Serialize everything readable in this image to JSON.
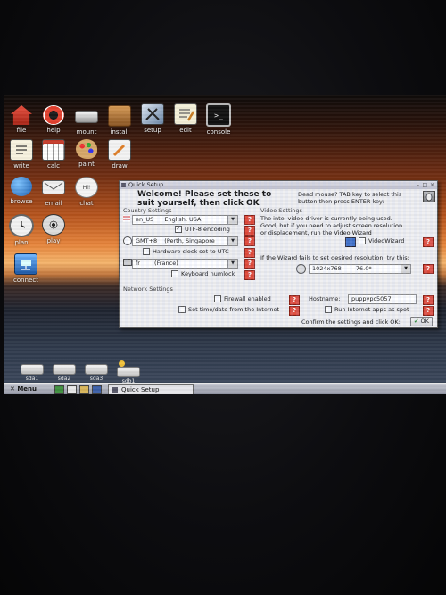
{
  "desktop": {
    "icons": [
      {
        "label": "file",
        "icon": "file-manager-icon"
      },
      {
        "label": "help",
        "icon": "help-lifebuoy-icon"
      },
      {
        "label": "mount",
        "icon": "drive-mount-icon"
      },
      {
        "label": "install",
        "icon": "install-box-icon"
      },
      {
        "label": "setup",
        "icon": "setup-tools-icon"
      },
      {
        "label": "edit",
        "icon": "text-editor-icon"
      },
      {
        "label": "console",
        "icon": "terminal-icon"
      },
      {
        "label": "write",
        "icon": "word-processor-icon"
      },
      {
        "label": "calc",
        "icon": "spreadsheet-icon"
      },
      {
        "label": "paint",
        "icon": "paint-palette-icon"
      },
      {
        "label": "draw",
        "icon": "draw-pencil-icon"
      },
      {
        "label": "browse",
        "icon": "globe-browser-icon"
      },
      {
        "label": "email",
        "icon": "envelope-email-icon"
      },
      {
        "label": "chat",
        "icon": "chat-bubble-icon"
      },
      {
        "label": "plan",
        "icon": "clock-planner-icon"
      },
      {
        "label": "play",
        "icon": "film-reel-icon"
      },
      {
        "label": "connect",
        "icon": "network-connect-icon"
      }
    ],
    "drives": [
      {
        "label": "sda1"
      },
      {
        "label": "sda2"
      },
      {
        "label": "sda3"
      },
      {
        "label": "sdb1"
      }
    ]
  },
  "taskbar": {
    "menu_label": "Menu",
    "task_label": "Quick Setup"
  },
  "dialog": {
    "title": "Quick Setup",
    "welcome_line1": "Welcome! Please set these to",
    "welcome_line2": "suit yourself, then click OK",
    "dead_mouse_line1": "Dead mouse? TAB key to select this",
    "dead_mouse_line2": "button then press ENTER key:",
    "country_section": "Country Settings",
    "locale_code": "en_US",
    "locale_name": "English, USA",
    "utf8_label": "UTF-8 encoding",
    "timezone_code": "GMT+8",
    "timezone_name": "(Perth, Singapore",
    "hw_clock_label": "Hardware clock set to UTC",
    "keyboard_code": "fr",
    "keyboard_name": "(France)",
    "numlock_label": "Keyboard numlock",
    "video_section": "Video Settings",
    "video_line1": "The intel video driver is currently being used.",
    "video_line2": "Good, but if you need to adjust screen resolution",
    "video_line3": "or displacement, run the Video Wizard",
    "video_wizard_label": "VideoWizard",
    "wizard_fail_text": "If the Wizard fails to set desired resolution, try this:",
    "resolution_value": "1024x768",
    "refresh_value": "76.0*",
    "network_section": "Network Settings",
    "firewall_label": "Firewall enabled",
    "hostname_label": "Hostname:",
    "hostname_value": "puppypc5057",
    "time_internet_label": "Set time/date from the Internet",
    "run_spot_label": "Run Internet apps as spot",
    "confirm_text": "Confirm the settings and click OK:",
    "ok_label": "OK"
  },
  "colors": {
    "help_button": "#e04a3a",
    "dialog_bg": "#efeff1"
  }
}
